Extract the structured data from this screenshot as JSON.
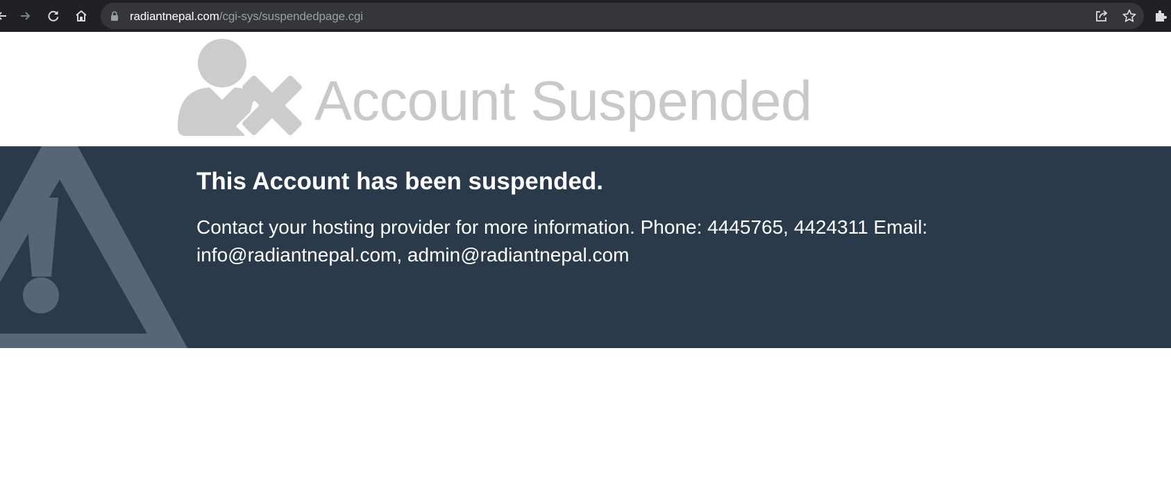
{
  "browser": {
    "url_domain": "radiantnepal.com",
    "url_path": "/cgi-sys/suspendedpage.cgi"
  },
  "header": {
    "title": "Account Suspended"
  },
  "banner": {
    "heading": "This Account has been suspended.",
    "message": "Contact your hosting provider for more information. Phone: 4445765, 4424311 Email: info@radiantnepal.com, admin@radiantnepal.com"
  },
  "icons": {
    "header_graphic": "user-suspended-icon",
    "banner_graphic": "warning-triangle-icon"
  },
  "colors": {
    "toolbar_bg": "#202124",
    "omnibox_bg": "#35363a",
    "header_title": "#c9c9c9",
    "banner_bg": "#2b3a4a",
    "banner_graphic": "#566676"
  }
}
